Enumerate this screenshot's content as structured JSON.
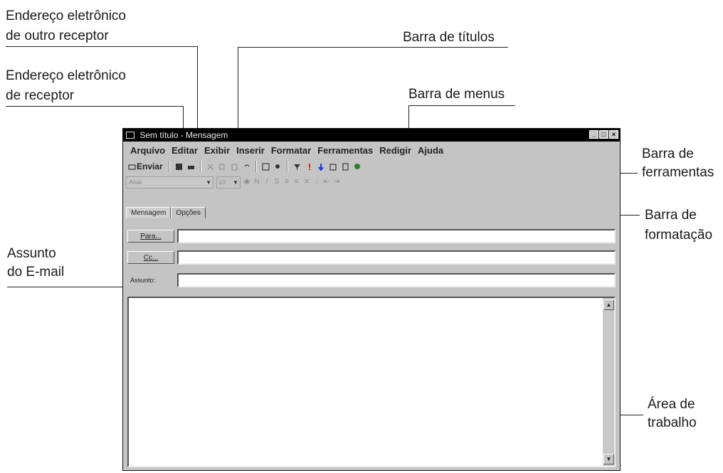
{
  "window": {
    "title": "Sem título - Mensagem",
    "controls": [
      "_",
      "□",
      "×"
    ]
  },
  "menu": [
    "Arquivo",
    "Editar",
    "Exibir",
    "Inserir",
    "Formatar",
    "Ferramentas",
    "Redigir",
    "Ajuda"
  ],
  "toolbar": {
    "send_label": "Enviar",
    "icons": [
      "save-icon",
      "print-icon",
      "cut-icon",
      "copy-icon",
      "paste-icon",
      "undo-icon",
      "address-book-icon",
      "check-names-icon",
      "filter-icon",
      "priority-high-icon",
      "priority-low-icon",
      "insert-file-icon",
      "signature-icon",
      "certificate-icon"
    ]
  },
  "format_bar": {
    "font": "Arial",
    "size": "10",
    "icons": [
      "color-icon",
      "bold-icon",
      "italic-icon",
      "underline-icon",
      "align-left-icon",
      "align-center-icon",
      "align-right-icon",
      "bullets-icon",
      "indent-less-icon",
      "indent-more-icon"
    ]
  },
  "tabs": [
    "Mensagem",
    "Opções"
  ],
  "fields": {
    "to_label": "Para...",
    "cc_label": "Cc...",
    "subject_label": "Assunto:",
    "to_value": "",
    "cc_value": "",
    "subject_value": ""
  },
  "callouts": {
    "outro_receptor_1": "Endereço eletrônico",
    "outro_receptor_2": "de outro receptor",
    "titulos": "Barra de títulos",
    "receptor_1": "Endereço eletrônico",
    "receptor_2": "de receptor",
    "menus": "Barra de menus",
    "ferramentas_1": "Barra de",
    "ferramentas_2": "ferramentas",
    "formatacao_1": "Barra de",
    "formatacao_2": "formatação",
    "assunto_1": "Assunto",
    "assunto_2": "do E-mail",
    "area_1": "Área de",
    "area_2": "trabalho"
  }
}
